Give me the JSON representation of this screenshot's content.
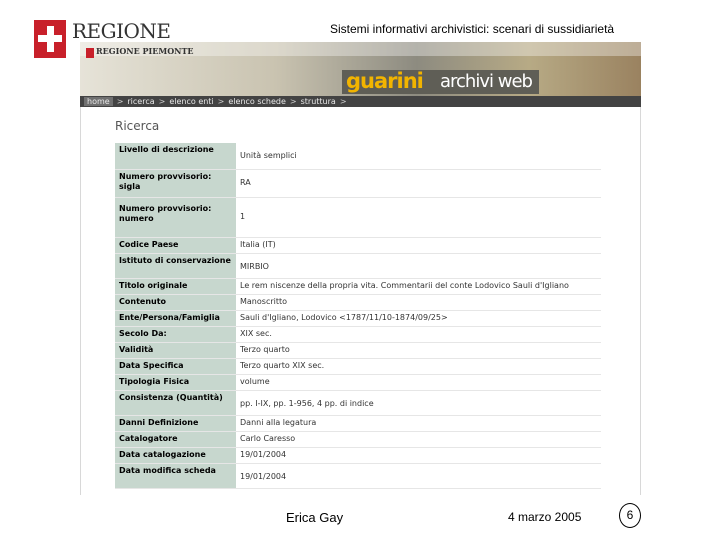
{
  "header": {
    "logo_text": "REGIONE",
    "slide_title": "Sistemi informativi archivistici: scenari di sussidiarietà"
  },
  "banner": {
    "mini_logo_text": "REGIONE PIEMONTE",
    "brand_guarini": "guarini",
    "brand_rest": "archivi web"
  },
  "nav": {
    "items": [
      "home",
      "ricerca",
      "elenco enti",
      "elenco schede",
      "struttura"
    ],
    "separator": ">"
  },
  "main": {
    "heading": "Ricerca",
    "rows": [
      {
        "label": "Livello di descrizione",
        "value": "Unità semplici"
      },
      {
        "label": "Numero provvisorio: sigla",
        "value": "RA"
      },
      {
        "label": "Numero provvisorio: numero",
        "value": "1"
      },
      {
        "label": "Codice Paese",
        "value": "Italia (IT)"
      },
      {
        "label": "Istituto di conservazione",
        "value": "MIRBIO"
      },
      {
        "label": "Titolo originale",
        "value": "Le rem niscenze della propria vita. Commentarii del conte Lodovico Sauli d'Igliano"
      },
      {
        "label": "Contenuto",
        "value": "Manoscritto"
      },
      {
        "label": "Ente/Persona/Famiglia",
        "value": "Sauli d'Igliano, Lodovico <1787/11/10-1874/09/25>"
      },
      {
        "label": "Secolo Da:",
        "value": "XIX sec."
      },
      {
        "label": "Validità",
        "value": "Terzo quarto"
      },
      {
        "label": "Data Specifica",
        "value": "Terzo quarto XIX sec."
      },
      {
        "label": "Tipologia Fisica",
        "value": "volume"
      },
      {
        "label": "Consistenza (Quantità)",
        "value": "pp. I-IX, pp. 1-956, 4 pp. di indice"
      },
      {
        "label": "Danni Definizione",
        "value": "Danni alla legatura"
      },
      {
        "label": "Catalogatore",
        "value": "Carlo Caresso"
      },
      {
        "label": "Data catalogazione",
        "value": "19/01/2004"
      },
      {
        "label": "Data modifica scheda",
        "value": "19/01/2004"
      }
    ]
  },
  "footer": {
    "author": "Erica Gay",
    "date": "4 marzo 2005",
    "page_number": "6"
  }
}
